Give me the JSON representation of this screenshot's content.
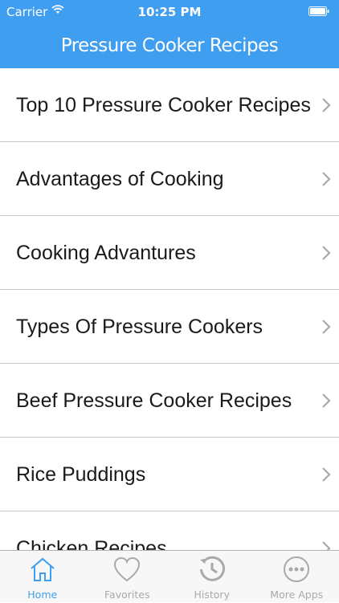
{
  "status_bar": {
    "carrier": "Carrier",
    "time": "10:25 PM"
  },
  "nav": {
    "title": "Pressure Cooker Recipes"
  },
  "list": {
    "items": [
      {
        "label": "Top 10 Pressure Cooker Recipes"
      },
      {
        "label": "Advantages of Cooking"
      },
      {
        "label": "Cooking Advantures"
      },
      {
        "label": "Types Of Pressure Cookers"
      },
      {
        "label": "Beef Pressure Cooker Recipes"
      },
      {
        "label": "Rice Puddings"
      },
      {
        "label": "Chicken Recipes"
      }
    ]
  },
  "tabbar": {
    "tabs": [
      {
        "label": "Home",
        "icon": "home-icon",
        "active": true
      },
      {
        "label": "Favorites",
        "icon": "heart-icon",
        "active": false
      },
      {
        "label": "History",
        "icon": "history-icon",
        "active": false
      },
      {
        "label": "More Apps",
        "icon": "more-icon",
        "active": false
      }
    ]
  },
  "colors": {
    "accent": "#3f9ef0",
    "tab_inactive": "#a9a9a9",
    "separator": "#c8c7cc"
  }
}
